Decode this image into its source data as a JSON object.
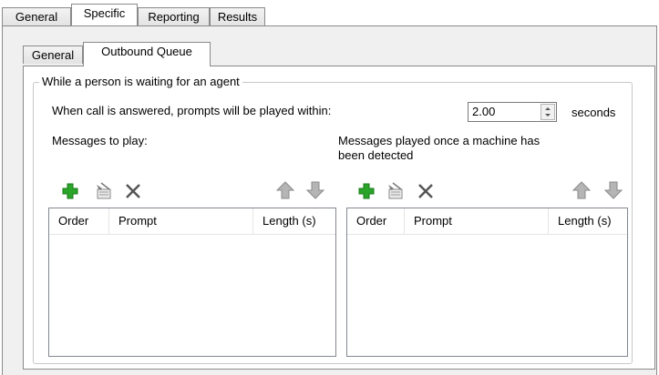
{
  "top_tabs": [
    "General",
    "Specific",
    "Reporting",
    "Results"
  ],
  "active_top_tab": "Specific",
  "inner_tabs": [
    "General",
    "Outbound Queue"
  ],
  "active_inner_tab": "Outbound Queue",
  "group": {
    "title": "While a person is waiting for an agent",
    "prompt_label": "When call is answered, prompts will be played within:",
    "prompt_value": "2.00",
    "prompt_unit": "seconds",
    "left_list": {
      "label": "Messages to play:",
      "columns": [
        "Order",
        "Prompt",
        "Length (s)"
      ],
      "rows": []
    },
    "right_list": {
      "label_line1": "Messages played once a machine has",
      "label_line2": "been detected",
      "columns": [
        "Order",
        "Prompt",
        "Length (s)"
      ],
      "rows": []
    }
  },
  "icons": {
    "add": "add-icon",
    "edit": "edit-prompt-icon",
    "delete": "delete-icon",
    "move_up": "arrow-up-icon",
    "move_down": "arrow-down-icon"
  },
  "colors": {
    "add_green": "#2aa52a",
    "arrow_gray": "#9a9a9a",
    "delete_gray": "#555555"
  }
}
